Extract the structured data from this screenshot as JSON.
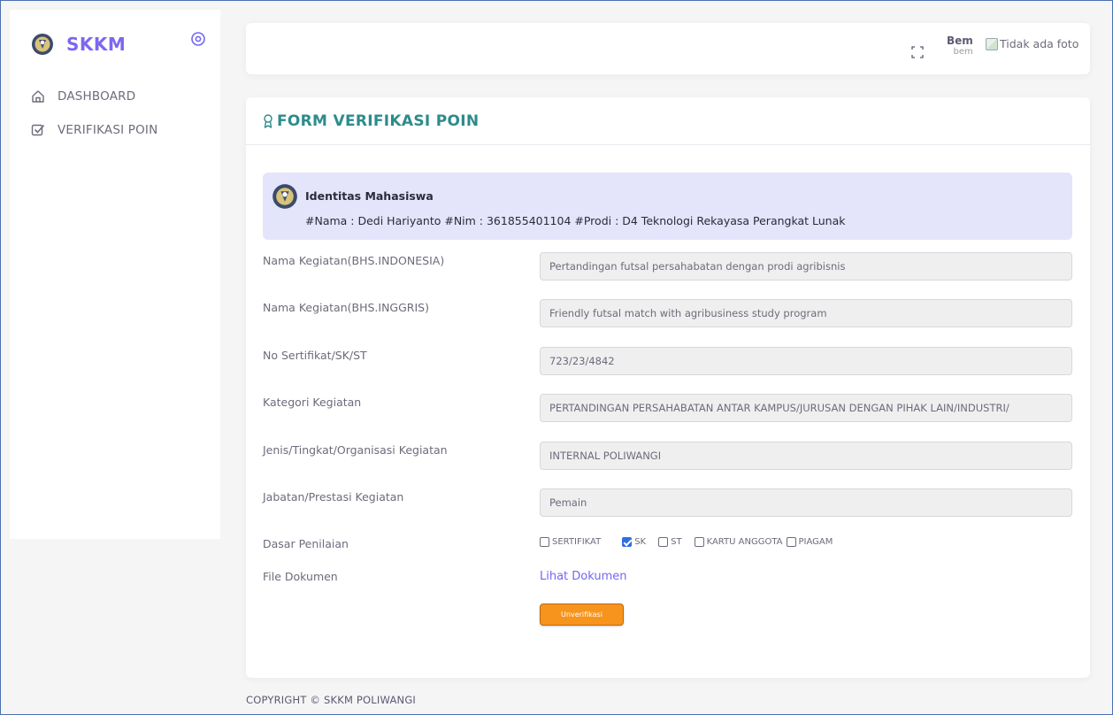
{
  "sidebar": {
    "brand": "SKKM",
    "items": [
      {
        "label": "DASHBOARD",
        "icon": "home-icon"
      },
      {
        "label": "VERIFIKASI POIN",
        "icon": "check-square-icon"
      }
    ]
  },
  "topbar": {
    "user_name": "Bem",
    "user_role": "bem",
    "avatar_alt": "Tidak ada foto"
  },
  "card": {
    "title": "FORM VERIFIKASI POIN",
    "identity": {
      "title": "Identitas Mahasiswa",
      "text": "#Nama : Dedi Hariyanto #Nim : 361855401104 #Prodi : D4 Teknologi Rekayasa Perangkat Lunak"
    },
    "fields": [
      {
        "label": "Nama Kegiatan(BHS.INDONESIA)",
        "value": "Pertandingan futsal persahabatan dengan prodi agribisnis"
      },
      {
        "label": "Nama Kegiatan(BHS.INGGRIS)",
        "value": "Friendly futsal match with agribusiness study program"
      },
      {
        "label": "No Sertifikat/SK/ST",
        "value": "723/23/4842"
      },
      {
        "label": "Kategori Kegiatan",
        "value": "PERTANDINGAN PERSAHABATAN ANTAR KAMPUS/JURUSAN DENGAN PIHAK LAIN/INDUSTRI/"
      },
      {
        "label": "Jenis/Tingkat/Organisasi Kegiatan",
        "value": "INTERNAL POLIWANGI"
      },
      {
        "label": "Jabatan/Prestasi Kegiatan",
        "value": "Pemain"
      }
    ],
    "dasar_label": "Dasar Penilaian",
    "dasar_options": [
      {
        "label": "SERTIFIKAT",
        "checked": false
      },
      {
        "label": "SK",
        "checked": true
      },
      {
        "label": "ST",
        "checked": false
      },
      {
        "label": "KARTU ANGGOTA",
        "checked": false
      },
      {
        "label": "PIAGAM",
        "checked": false
      }
    ],
    "file_label": "File Dokumen",
    "file_link": "Lihat Dokumen",
    "button": "Unverifikasi"
  },
  "footer": "COPYRIGHT © SKKM POLIWANGI",
  "colors": {
    "brand": "#7b68ee",
    "title": "#2e8b8b",
    "accent": "#7367f0",
    "button": "#f7941d"
  }
}
